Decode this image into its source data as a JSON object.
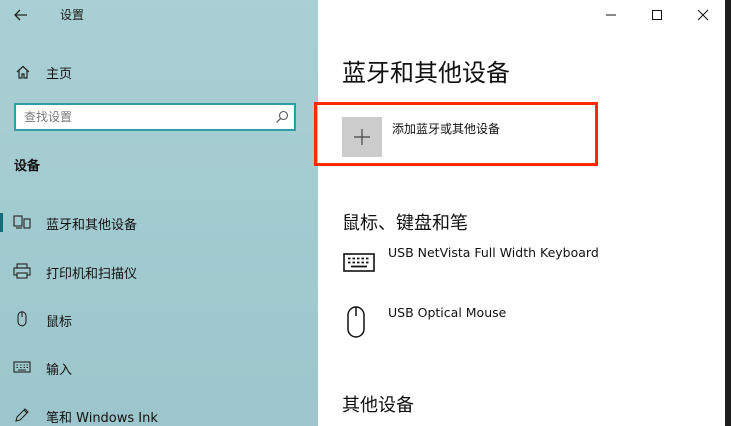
{
  "window": {
    "title": "设置",
    "controls": {
      "minimize": "minimize-icon",
      "maximize": "maximize-icon",
      "close": "close-icon"
    }
  },
  "sidebar": {
    "home_label": "主页",
    "search": {
      "placeholder": "查找设置",
      "value": ""
    },
    "section_heading": "设备",
    "items": [
      {
        "label": "蓝牙和其他设备",
        "icon": "bluetooth-devices-icon",
        "selected": true
      },
      {
        "label": "打印机和扫描仪",
        "icon": "printer-icon",
        "selected": false
      },
      {
        "label": "鼠标",
        "icon": "mouse-icon",
        "selected": false
      },
      {
        "label": "输入",
        "icon": "keyboard-icon",
        "selected": false
      },
      {
        "label": "笔和 Windows Ink",
        "icon": "pen-icon",
        "selected": false
      }
    ]
  },
  "main": {
    "title": "蓝牙和其他设备",
    "add_device_label": "添加蓝牙或其他设备",
    "sections": [
      {
        "heading": "鼠标、键盘和笔",
        "devices": [
          {
            "name": "USB NetVista Full Width Keyboard",
            "icon": "keyboard-icon"
          },
          {
            "name": "USB Optical Mouse",
            "icon": "mouse-icon"
          }
        ]
      },
      {
        "heading": "其他设备",
        "devices": []
      }
    ]
  },
  "colors": {
    "sidebar_bg": "#a6ced2",
    "search_border": "#2f9ea6",
    "selected_indicator": "#0f6f78",
    "highlight": "#ff2a00",
    "plus_tile": "#cccccc"
  }
}
